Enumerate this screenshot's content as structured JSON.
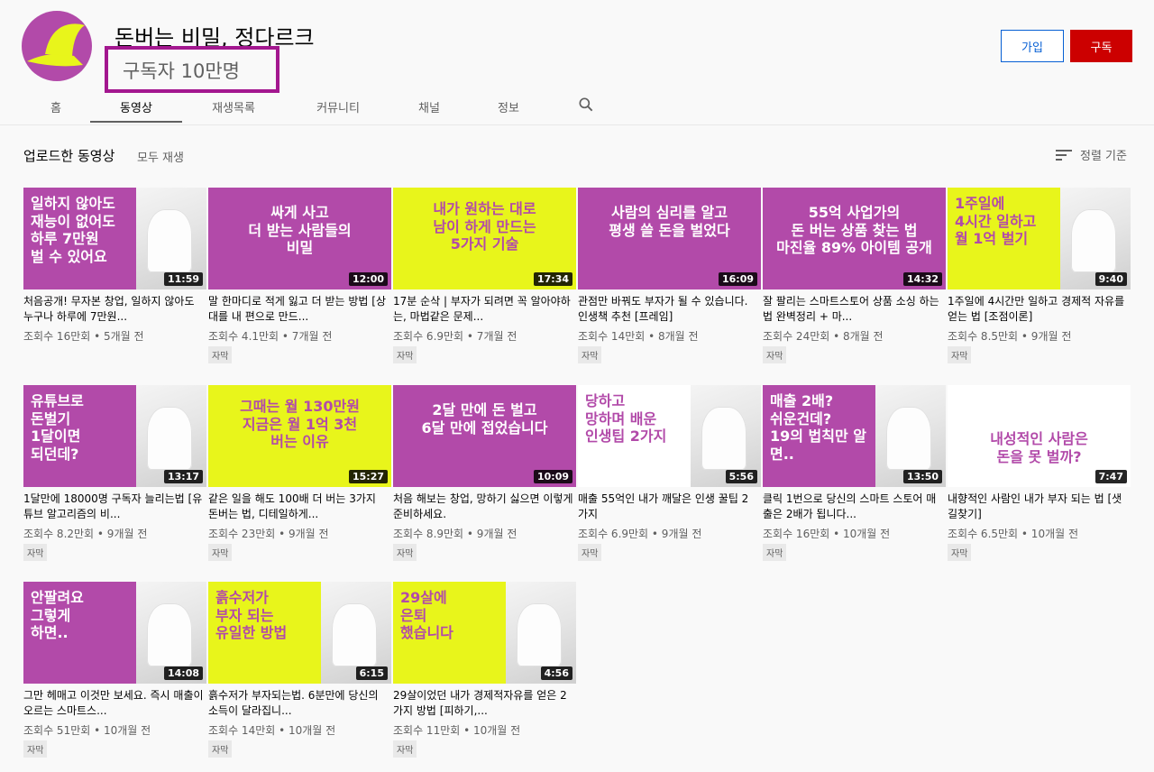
{
  "channel": {
    "name": "돈버는 비밀, 정다르크",
    "subscribers": "구독자 10만명",
    "join_label": "가입",
    "subscribe_label": "구독",
    "avatar_bg": "#b24aa9",
    "avatar_fg": "#e8f51b"
  },
  "tabs": [
    {
      "label": "홈"
    },
    {
      "label": "동영상"
    },
    {
      "label": "재생목록"
    },
    {
      "label": "커뮤니티"
    },
    {
      "label": "채널"
    },
    {
      "label": "정보"
    }
  ],
  "shelf": {
    "title": "업로드한 동영상",
    "play_all": "모두 재생",
    "sort_label": "정렬 기준"
  },
  "colors": {
    "magenta": "#b24aa9",
    "yellow": "#e8f51b",
    "white": "#ffffff"
  },
  "videos": [
    {
      "thumb_text": "일하지 않아도\n재능이 없어도\n하루 7만원\n벌 수 있어요",
      "bg": "magenta",
      "duration": "11:59",
      "title": "처음공개! 무자본 창업, 일하지 않아도 누구나 하루에 7만원...",
      "meta": "조회수 16만회 • 5개월 전",
      "badge": ""
    },
    {
      "thumb_text": "싸게 사고\n더 받는 사람들의\n비밀",
      "bg": "magenta",
      "duration": "12:00",
      "title": "말 한마디로 적게 잃고 더 받는 방법 [상대를 내 편으로 만드...",
      "meta": "조회수 4.1만회 • 7개월 전",
      "badge": "자막"
    },
    {
      "thumb_text": "내가 원하는 대로\n남이 하게 만드는\n5가지 기술",
      "bg": "yellow",
      "duration": "17:34",
      "title": "17분 순삭 | 부자가 되려면 꼭 알아야하는, 마법같은 문제...",
      "meta": "조회수 6.9만회 • 7개월 전",
      "badge": "자막"
    },
    {
      "thumb_text": "사람의 심리를 알고\n평생 쓸 돈을 벌었다",
      "bg": "magenta",
      "duration": "16:09",
      "title": "관점만 바꿔도 부자가 될 수 있습니다. 인생책 추천 [프레임]",
      "meta": "조회수 14만회 • 8개월 전",
      "badge": "자막"
    },
    {
      "thumb_text": "55억 사업가의\n돈 버는 상품 찾는 법\n마진율 89% 아이템 공개",
      "bg": "magenta",
      "duration": "14:32",
      "title": "잘 팔리는 스마트스토어 상품 소싱 하는 법 완벽정리 + 마...",
      "meta": "조회수 24만회 • 8개월 전",
      "badge": "자막"
    },
    {
      "thumb_text": "1주일에\n4시간 일하고\n월 1억 벌기",
      "bg": "yellow",
      "duration": "9:40",
      "title": "1주일에 4시간만 일하고 경제적 자유를 얻는 법 [조점이론]",
      "meta": "조회수 8.5만회 • 9개월 전",
      "badge": "자막"
    },
    {
      "thumb_text": "유튜브로\n돈벌기\n1달이면\n되던데?",
      "bg": "magenta",
      "duration": "13:17",
      "title": "1달만에 18000명 구독자 늘리는법 [유튜브 알고리즘의 비...",
      "meta": "조회수 8.2만회 • 9개월 전",
      "badge": "자막"
    },
    {
      "thumb_text": "그때는 월 130만원\n지금은 월 1억 3천\n버는 이유",
      "bg": "yellow",
      "duration": "15:27",
      "title": "같은 일을 해도 100배 더 버는 3가지 돈버는 법, 디테일하게...",
      "meta": "조회수 23만회 • 9개월 전",
      "badge": "자막"
    },
    {
      "thumb_text": "2달 만에 돈 벌고\n6달 만에 접었습니다",
      "bg": "magenta",
      "duration": "10:09",
      "title": "처음 해보는 창업, 망하기 싫으면 이렇게 준비하세요.",
      "meta": "조회수 8.9만회 • 9개월 전",
      "badge": "자막"
    },
    {
      "thumb_text": "당하고\n망하며 배운\n인생팁 2가지",
      "bg": "white",
      "duration": "5:56",
      "title": "매출 55억인 내가 깨달은 인생 꿀팁 2가지",
      "meta": "조회수 6.9만회 • 9개월 전",
      "badge": "자막"
    },
    {
      "thumb_text": "매출 2배?\n쉬운건데?\n19의 법칙만 알면..",
      "bg": "magenta",
      "duration": "13:50",
      "title": "클릭 1번으로 당신의 스마트 스토어 매출은 2배가 됩니다...",
      "meta": "조회수 16만회 • 10개월 전",
      "badge": "자막"
    },
    {
      "thumb_text": "내성적인 사람은\n돈을 못 벌까?",
      "bg": "white",
      "duration": "7:47",
      "title": "내향적인 사람인 내가 부자 되는 법 [샛길찾기]",
      "meta": "조회수 6.5만회 • 10개월 전",
      "badge": "자막"
    },
    {
      "thumb_text": "안팔려요\n그렇게\n하면..",
      "bg": "magenta",
      "duration": "14:08",
      "title": "그만 헤매고 이것만 보세요. 즉시 매출이 오르는 스마트스...",
      "meta": "조회수 51만회 • 10개월 전",
      "badge": "자막"
    },
    {
      "thumb_text": "흙수저가\n부자 되는\n유일한 방법",
      "bg": "yellow",
      "duration": "6:15",
      "title": "흙수저가 부자되는법. 6분만에 당신의 소득이 달라집니...",
      "meta": "조회수 14만회 • 10개월 전",
      "badge": "자막"
    },
    {
      "thumb_text": "29살에\n은퇴\n했습니다",
      "bg": "yellow",
      "duration": "4:56",
      "title": "29살이었던 내가 경제적자유를 얻은 2가지 방법 [피하기,...",
      "meta": "조회수 11만회 • 10개월 전",
      "badge": "자막"
    }
  ]
}
